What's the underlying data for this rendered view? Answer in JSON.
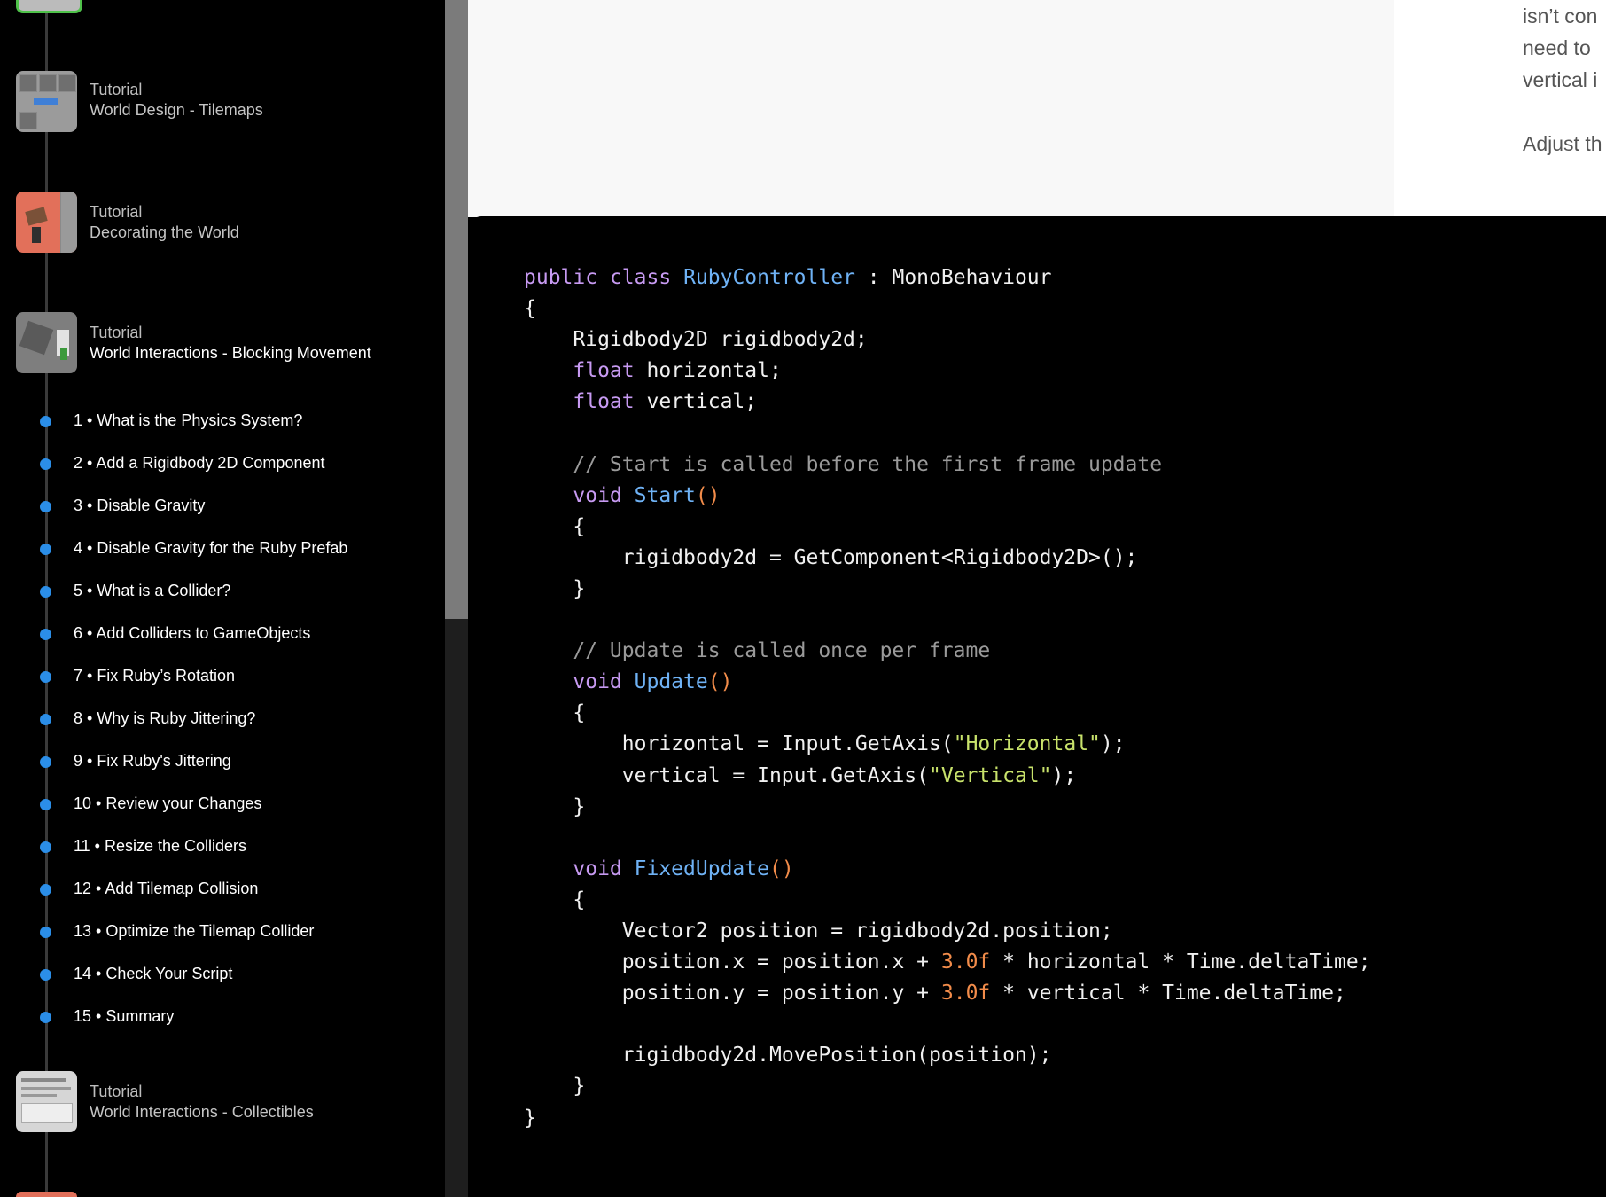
{
  "sidebar": {
    "tutorials": [
      {
        "title": "Tutorial",
        "subtitle": "World Design - Tilemaps"
      },
      {
        "title": "Tutorial",
        "subtitle": "Decorating the World"
      },
      {
        "title": "Tutorial",
        "subtitle": "World Interactions - Blocking Movement"
      },
      {
        "title": "Tutorial",
        "subtitle": "World Interactions - Collectibles"
      }
    ],
    "steps": [
      "1 • What is the Physics System?",
      "2 • Add a Rigidbody 2D Component",
      "3 • Disable Gravity",
      "4 • Disable Gravity for the Ruby Prefab",
      "5 • What is a Collider?",
      "6 • Add Colliders to GameObjects",
      "7 • Fix Ruby’s Rotation",
      "8 • Why is Ruby Jittering?",
      "9 • Fix Ruby's Jittering",
      "10 • Review your Changes",
      "11 • Resize the Colliders",
      "12 • Add Tilemap Collision",
      "13 • Optimize the Tilemap Collider",
      "14 • Check Your Script",
      "15 • Summary"
    ],
    "colors": {
      "step_dot": "#2b8ee8",
      "completed_ring": "#4fc24a"
    }
  },
  "article": {
    "partial_lines": [
      "isn’t con",
      "need to",
      "vertical i",
      "",
      "Adjust th"
    ]
  },
  "code": {
    "language": "csharp",
    "lines": [
      "public class RubyController : MonoBehaviour",
      "{",
      "    Rigidbody2D rigidbody2d;",
      "    float horizontal;",
      "    float vertical;",
      "",
      "    // Start is called before the first frame update",
      "    void Start()",
      "    {",
      "        rigidbody2d = GetComponent<Rigidbody2D>();",
      "    }",
      "",
      "    // Update is called once per frame",
      "    void Update()",
      "    {",
      "        horizontal = Input.GetAxis(\"Horizontal\");",
      "        vertical = Input.GetAxis(\"Vertical\");",
      "    }",
      "",
      "    void FixedUpdate()",
      "    {",
      "        Vector2 position = rigidbody2d.position;",
      "        position.x = position.x + 3.0f * horizontal * Time.deltaTime;",
      "        position.y = position.y + 3.0f * vertical * Time.deltaTime;",
      "",
      "        rigidbody2d.MovePosition(position);",
      "    }",
      "}"
    ]
  }
}
